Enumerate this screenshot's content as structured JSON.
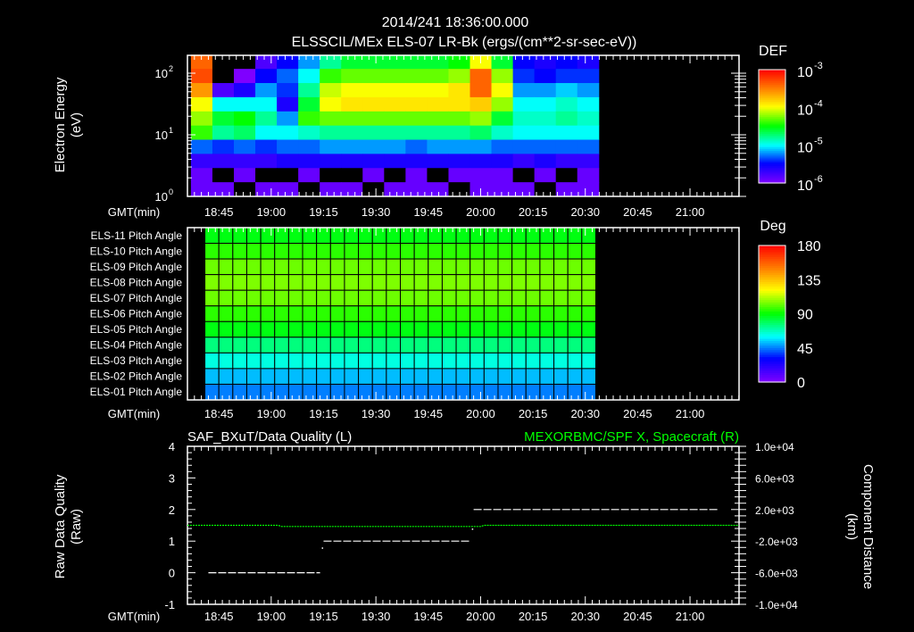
{
  "header": {
    "timestamp": "2014/241 18:36:00.000"
  },
  "colors": {
    "background": "#000000",
    "axis": "#ffffff",
    "component_series": "#00ff00",
    "quality_series": "#ffffff"
  },
  "chart_data": [
    {
      "type": "heatmap",
      "title": "ELSSCIL/MEx ELS-07 LR-Bk  (ergs/(cm**2-sr-sec-eV))",
      "xlabel": "GMT(min)",
      "ylabel": [
        "Electron Energy",
        "(eV)"
      ],
      "xlim": [
        "18:36",
        "21:14"
      ],
      "x_ticks": [
        "18:45",
        "19:00",
        "19:15",
        "19:30",
        "19:45",
        "20:00",
        "20:15",
        "20:30",
        "20:45",
        "21:00"
      ],
      "y_scale": "log",
      "ylim": [
        1,
        195
      ],
      "y_ticks": [
        {
          "base": "10",
          "exp": "0",
          "value": 1
        },
        {
          "base": "10",
          "exp": "1",
          "value": 10
        },
        {
          "base": "10",
          "exp": "2",
          "value": 100
        }
      ],
      "colorbar": {
        "title": "DEF",
        "log_range": [
          -6,
          -3
        ],
        "ticks": [
          {
            "base": "10",
            "exp": "-3",
            "value": -3
          },
          {
            "base": "10",
            "exp": "-4",
            "value": -4
          },
          {
            "base": "10",
            "exp": "-5",
            "value": -5
          },
          {
            "base": "10",
            "exp": "-6",
            "value": -6
          }
        ]
      },
      "time_start": "18:37",
      "bin_minutes": 6.15,
      "energy_log10_top": 2.3,
      "energy_log10_bin": 0.23,
      "z_log10_rows_high_to_low_energy": [
        [
          -3.4,
          -6.1,
          -6.1,
          -5.8,
          -5.5,
          -5.2,
          -4.8,
          -4.6,
          -4.6,
          -4.6,
          -4.6,
          -4.6,
          -4.5,
          -4.0,
          -4.6,
          -5.5,
          -5.6,
          -5.5,
          -5.6
        ],
        [
          -3.3,
          -6.1,
          -6.0,
          -5.5,
          -5.3,
          -5.0,
          -4.4,
          -4.3,
          -4.3,
          -4.3,
          -4.3,
          -4.3,
          -4.2,
          -3.4,
          -4.2,
          -5.4,
          -5.5,
          -5.4,
          -5.4
        ],
        [
          -3.6,
          -5.8,
          -5.6,
          -5.2,
          -5.4,
          -4.8,
          -4.1,
          -4.0,
          -4.0,
          -4.0,
          -4.0,
          -4.0,
          -3.9,
          -3.4,
          -4.0,
          -5.2,
          -5.2,
          -5.1,
          -5.2
        ],
        [
          -4.0,
          -5.0,
          -5.0,
          -5.0,
          -5.6,
          -4.6,
          -4.0,
          -3.9,
          -3.9,
          -3.9,
          -3.9,
          -3.9,
          -3.9,
          -3.8,
          -4.2,
          -5.0,
          -5.0,
          -4.9,
          -5.0
        ],
        [
          -4.2,
          -4.6,
          -4.5,
          -4.8,
          -5.2,
          -4.4,
          -4.3,
          -4.3,
          -4.3,
          -4.3,
          -4.3,
          -4.3,
          -4.3,
          -4.2,
          -4.6,
          -4.9,
          -4.9,
          -4.8,
          -4.9
        ],
        [
          -4.4,
          -4.8,
          -4.7,
          -5.0,
          -5.0,
          -4.9,
          -4.8,
          -4.8,
          -4.8,
          -4.8,
          -4.8,
          -4.8,
          -4.8,
          -4.7,
          -4.9,
          -5.0,
          -5.0,
          -5.0,
          -5.0
        ],
        [
          -5.3,
          -5.4,
          -5.3,
          -5.4,
          -5.3,
          -5.3,
          -5.2,
          -5.2,
          -5.2,
          -5.2,
          -5.3,
          -5.2,
          -5.2,
          -5.2,
          -5.3,
          -5.3,
          -5.3,
          -5.3,
          -5.3
        ],
        [
          -5.7,
          -5.7,
          -5.7,
          -5.7,
          -5.6,
          -5.6,
          -5.6,
          -5.6,
          -5.6,
          -5.6,
          -5.6,
          -5.6,
          -5.6,
          -5.6,
          -5.6,
          -5.7,
          -5.6,
          -5.7,
          -5.7
        ],
        [
          -5.9,
          -6.1,
          -5.9,
          -6.1,
          -6.1,
          -5.9,
          -6.1,
          -6.1,
          -5.9,
          -6.1,
          -5.9,
          -6.1,
          -5.9,
          -5.9,
          -5.9,
          -6.1,
          -5.9,
          -6.1,
          -5.9
        ],
        [
          -5.9,
          -5.9,
          -6.1,
          -5.9,
          -5.9,
          -6.1,
          -5.9,
          -5.9,
          -6.1,
          -5.9,
          -5.9,
          -5.9,
          -6.1,
          -5.9,
          -5.9,
          -5.9,
          -6.1,
          -5.9,
          -5.9
        ]
      ]
    },
    {
      "type": "heatmap",
      "xlabel": "GMT(min)",
      "xlim": [
        "18:36",
        "21:14"
      ],
      "x_ticks": [
        "18:45",
        "19:00",
        "19:15",
        "19:30",
        "19:45",
        "20:00",
        "20:15",
        "20:30",
        "20:45",
        "21:00"
      ],
      "colorbar": {
        "title": "Deg",
        "range": [
          0,
          180
        ],
        "ticks": [
          "180",
          "135",
          "90",
          "45",
          "0"
        ]
      },
      "time_start": "18:41",
      "bin_minutes": 4,
      "n_bins": 28,
      "rows_top_to_bottom": [
        {
          "label": "ELS-11 Pitch Angle",
          "pitch_deg": 88
        },
        {
          "label": "ELS-10 Pitch Angle",
          "pitch_deg": 95
        },
        {
          "label": "ELS-09 Pitch Angle",
          "pitch_deg": 103
        },
        {
          "label": "ELS-08 Pitch Angle",
          "pitch_deg": 105
        },
        {
          "label": "ELS-07 Pitch Angle",
          "pitch_deg": 103
        },
        {
          "label": "ELS-06 Pitch Angle",
          "pitch_deg": 95
        },
        {
          "label": "ELS-05 Pitch Angle",
          "pitch_deg": 88
        },
        {
          "label": "ELS-04 Pitch Angle",
          "pitch_deg": 75
        },
        {
          "label": "ELS-03 Pitch Angle",
          "pitch_deg": 63
        },
        {
          "label": "ELS-02 Pitch Angle",
          "pitch_deg": 52
        },
        {
          "label": "ELS-01 Pitch Angle",
          "pitch_deg": 45
        }
      ]
    },
    {
      "type": "line",
      "title_left": "SAF_BXuT/Data Quality (L)",
      "title_right": "MEXORBMC/SPF X, Spacecraft (R)",
      "xlabel": "GMT(min)",
      "ylabel_left": [
        "Raw Data Quality",
        "(Raw)"
      ],
      "ylabel_right": [
        "Component Distance",
        "(km)"
      ],
      "xlim": [
        "18:36",
        "21:14"
      ],
      "x_ticks": [
        "18:45",
        "19:00",
        "19:15",
        "19:30",
        "19:45",
        "20:00",
        "20:15",
        "20:30",
        "20:45",
        "21:00"
      ],
      "ylim_left": [
        -1,
        4
      ],
      "y_ticks_left": [
        "4",
        "3",
        "2",
        "1",
        "0",
        "-1"
      ],
      "ylim_right": [
        -10000,
        10000
      ],
      "y_ticks_right": [
        "1.0e+04",
        "6.0e+03",
        "2.0e+03",
        "-2.0e+03",
        "-6.0e+03",
        "-1.0e+04"
      ],
      "series": [
        {
          "name": "Data Quality",
          "axis": "left",
          "segments": [
            {
              "start": "18:42",
              "end": "19:14",
              "value": 0
            },
            {
              "start": "19:15",
              "end": "19:57",
              "value": 1
            },
            {
              "start": "19:58",
              "end": "21:08",
              "value": 2
            }
          ],
          "points": [
            {
              "t": "19:14.5",
              "value": 0.8
            },
            {
              "t": "19:57.5",
              "value": 1.4
            }
          ]
        },
        {
          "name": "MEXORBMC/SPF X",
          "axis": "right",
          "x": [
            "18:36",
            "19:02",
            "19:03",
            "20:00",
            "20:01",
            "21:14"
          ],
          "y": [
            0,
            0,
            -150,
            -150,
            0,
            0
          ]
        }
      ]
    }
  ]
}
